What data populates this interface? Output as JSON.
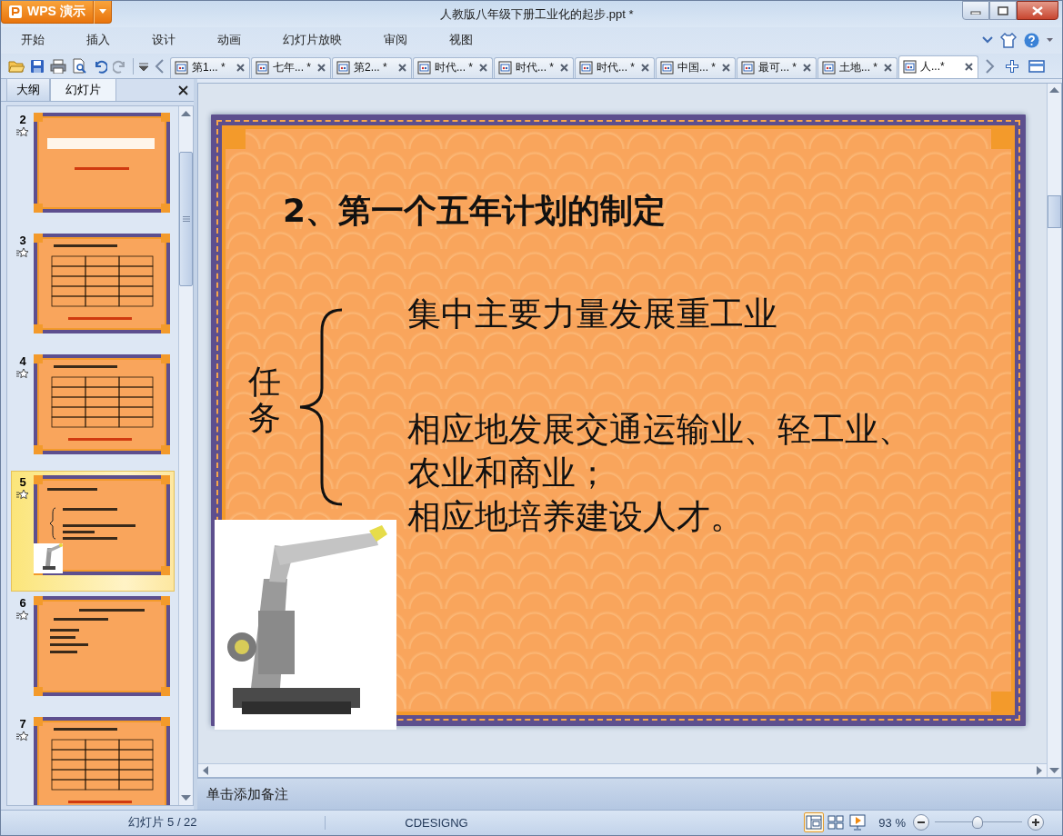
{
  "window": {
    "app_button": "WPS 演示",
    "title": "人教版八年级下册工业化的起步.ppt *"
  },
  "menu": [
    "开始",
    "插入",
    "设计",
    "动画",
    "幻灯片放映",
    "审阅",
    "视图"
  ],
  "doc_tabs": [
    {
      "label": "第1... *",
      "selected": false
    },
    {
      "label": "七年... *",
      "selected": false
    },
    {
      "label": "第2... *",
      "selected": false
    },
    {
      "label": "时代... *",
      "selected": false
    },
    {
      "label": "时代... *",
      "selected": false
    },
    {
      "label": "时代... *",
      "selected": false
    },
    {
      "label": "中国... *",
      "selected": false
    },
    {
      "label": "最可... *",
      "selected": false
    },
    {
      "label": "土地... *",
      "selected": false
    },
    {
      "label": "人...*",
      "selected": true
    }
  ],
  "side_panel": {
    "tabs": [
      {
        "label": "大纲",
        "selected": false
      },
      {
        "label": "幻灯片",
        "selected": true
      }
    ],
    "thumbnails": [
      {
        "number": "2",
        "kind": "title",
        "selected": false
      },
      {
        "number": "3",
        "kind": "table",
        "selected": false
      },
      {
        "number": "4",
        "kind": "table",
        "selected": false
      },
      {
        "number": "5",
        "kind": "bullets",
        "selected": true
      },
      {
        "number": "6",
        "kind": "list",
        "selected": false
      },
      {
        "number": "7",
        "kind": "table",
        "selected": false
      }
    ]
  },
  "slide": {
    "title": "2、第一个五年计划的制定",
    "side_label": "任务",
    "lines": [
      "集中主要力量发展重工业",
      "相应地发展交通运输业、轻工业、",
      "农业和商业；",
      "相应地培养建设人才。"
    ]
  },
  "notes": {
    "placeholder": "单击添加备注"
  },
  "status_bar": {
    "slide_counter": "幻灯片 5 / 22",
    "theme": "CDESIGNG",
    "views": [
      {
        "kind": "normal",
        "selected": true
      },
      {
        "kind": "sorter",
        "selected": false
      },
      {
        "kind": "show",
        "selected": false
      }
    ],
    "zoom": "93 %",
    "zoom_slider": {
      "level": 0.48
    }
  }
}
